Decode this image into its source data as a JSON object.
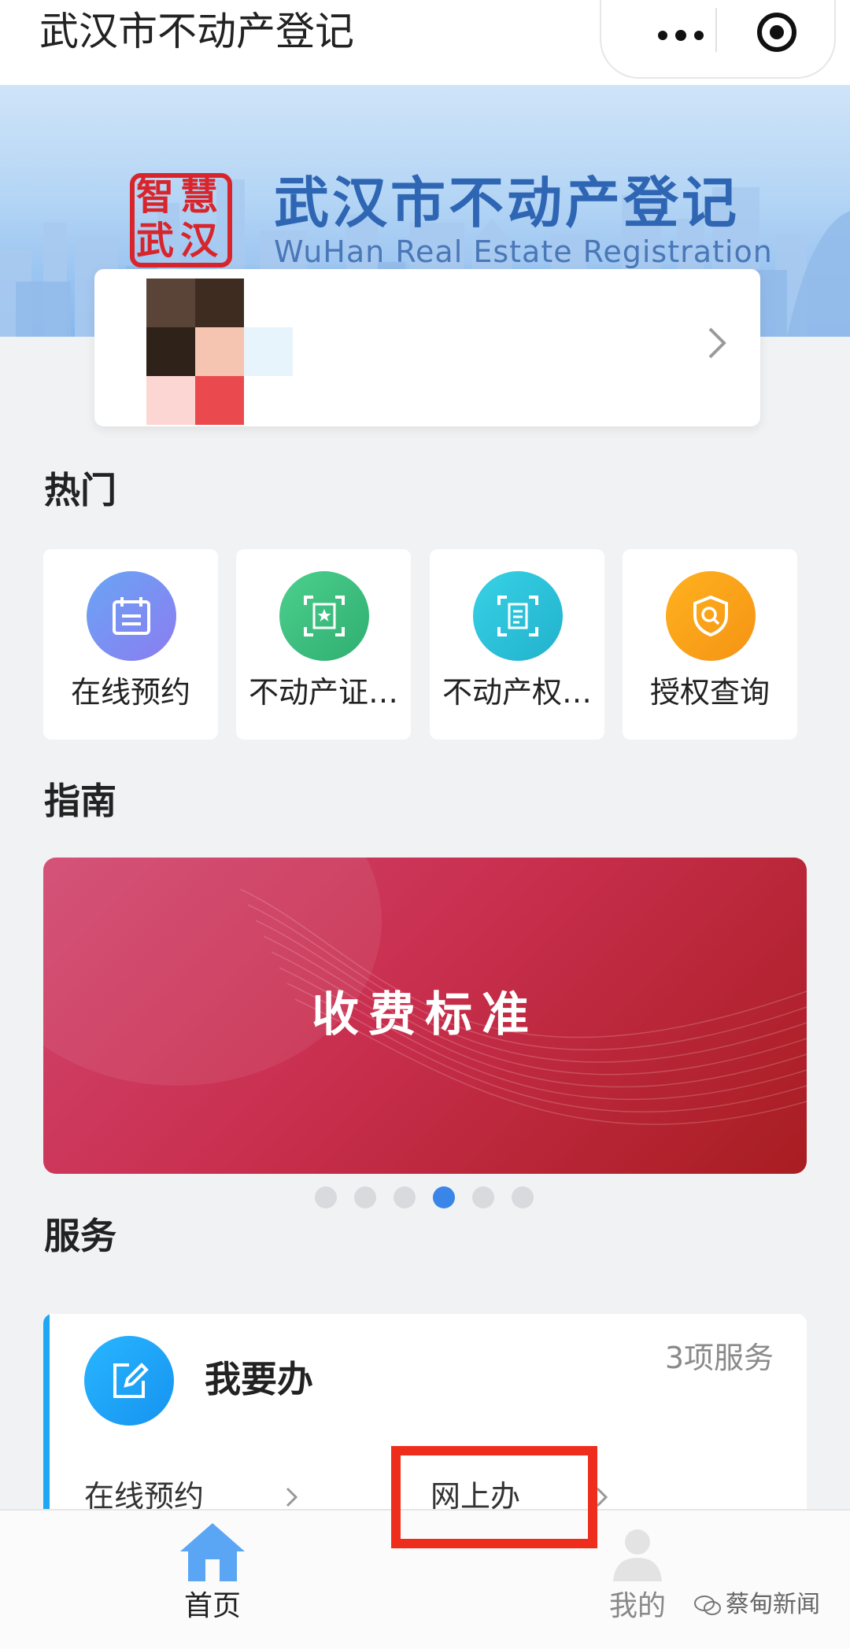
{
  "titlebar": {
    "title": "武汉市不动产登记"
  },
  "banner": {
    "seal_chars": [
      "智",
      "慧",
      "武",
      "汉"
    ],
    "title": "武汉市不动产登记",
    "subtitle": "WuHan Real Estate Registration"
  },
  "sections": {
    "hot": "热门",
    "guide": "指南",
    "service": "服务"
  },
  "hot_items": [
    {
      "label": "在线预约",
      "icon": "calendar-icon",
      "color": "#8b7cf0"
    },
    {
      "label": "不动产证…",
      "icon": "certificate-scan-icon",
      "color": "#3fbf7f"
    },
    {
      "label": "不动产权…",
      "icon": "document-scan-icon",
      "color": "#2bc4d8"
    },
    {
      "label": "授权查询",
      "icon": "shield-search-icon",
      "color": "#f7a11a"
    }
  ],
  "guide": {
    "banner_text": "收费标准",
    "active_slide": 4,
    "slide_count": 6
  },
  "service": {
    "title": "我要办",
    "count": "3项服务",
    "links": [
      "在线预约",
      "网上办"
    ],
    "icon": "edit-icon"
  },
  "tabbar": {
    "tabs": [
      {
        "label": "首页",
        "icon": "home-icon",
        "active": true
      },
      {
        "label": "我的",
        "icon": "person-icon",
        "active": false
      }
    ]
  },
  "watermark": "蔡甸新闻",
  "colors": {
    "brand_blue": "#2f66b4",
    "active_tab": "#4a9af0",
    "highlight": "#ef2d1d"
  }
}
